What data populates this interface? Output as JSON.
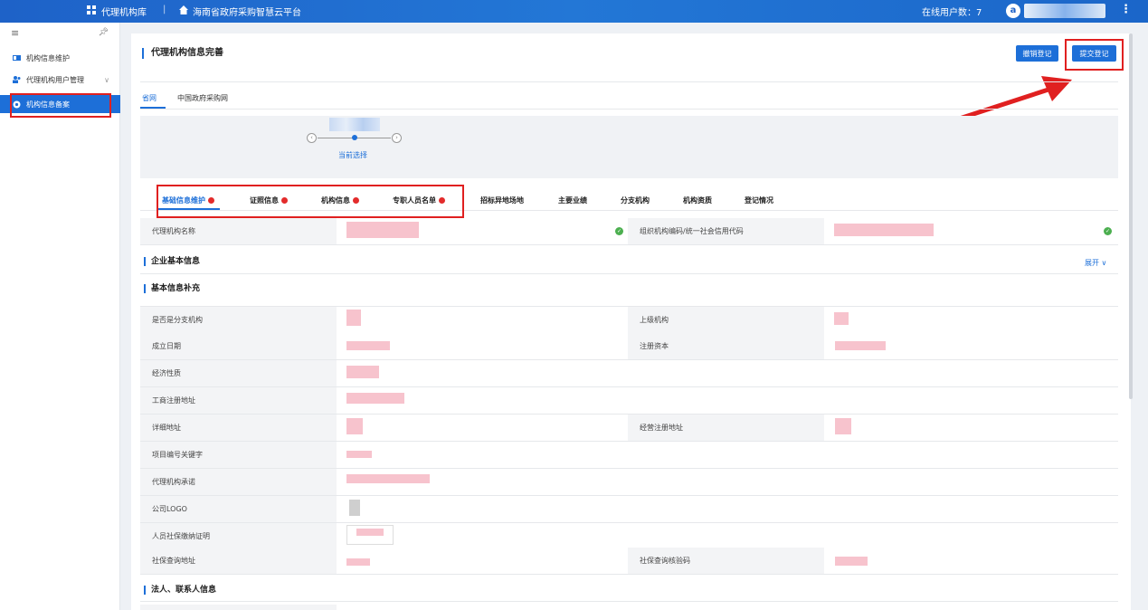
{
  "topbar": {
    "app_title": "代理机构库",
    "separator": "|",
    "platform": "海南省政府采购智慧云平台",
    "online_users": "在线用户数：7",
    "avatar_initial": "a"
  },
  "sidebar": {
    "items": [
      {
        "label": "机构信息维护"
      },
      {
        "label": "代理机构用户管理"
      },
      {
        "label": "机构信息备案"
      }
    ]
  },
  "page": {
    "title": "代理机构信息完善",
    "cancel_label": "撤销登记",
    "submit_label": "提交登记"
  },
  "network_tabs": [
    "省网",
    "中国政府采购网"
  ],
  "steps": {
    "current_label": "当前选择"
  },
  "sub_tabs": [
    {
      "label": "基础信息维护"
    },
    {
      "label": "证照信息"
    },
    {
      "label": "机构信息"
    },
    {
      "label": "专职人员名单"
    },
    {
      "label": "招标异地场地"
    },
    {
      "label": "主要业绩"
    },
    {
      "label": "分支机构"
    },
    {
      "label": "机构资质"
    },
    {
      "label": "登记情况"
    }
  ],
  "form": {
    "agency_name": "代理机构名称",
    "org_code": "组织机构编码/统一社会信用代码",
    "section_enterprise": "企业基本信息",
    "expand": "展开 ∨",
    "section_supplement": "基本信息补充",
    "is_branch": "是否是分支机构",
    "parent_org": "上级机构",
    "founded": "成立日期",
    "capital": "注册资本",
    "econ_nature": "经济性质",
    "reg_address": "工商注册地址",
    "detail_address": "详细地址",
    "biz_address": "经营注册地址",
    "keyword": "项目编号关键字",
    "promise": "代理机构承诺",
    "logo": "公司LOGO",
    "insurance": "人员社保缴纳证明",
    "social_url": "社保查询地址",
    "social_code": "社保查询核验码",
    "section_legal": "法人、联系人信息"
  },
  "colors": {
    "primary": "#1d6fd8",
    "highlight": "#e02020",
    "required_dot": "#e32b2b",
    "ok": "#4caf50"
  }
}
